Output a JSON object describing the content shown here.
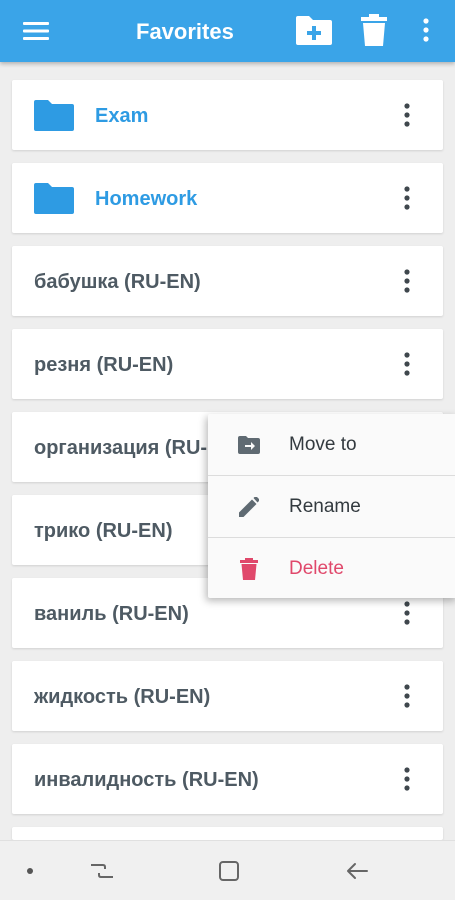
{
  "appbar": {
    "title": "Favorites",
    "icons": [
      "menu-icon",
      "add-folder-icon",
      "trash-icon",
      "more-vert-icon"
    ],
    "color": "#3aa4e8"
  },
  "list": {
    "folders": [
      {
        "label": "Exam"
      },
      {
        "label": "Homework"
      }
    ],
    "words": [
      {
        "label": "бабушка (RU-EN)"
      },
      {
        "label": "резня (RU-EN)"
      },
      {
        "label": "организация (RU-EN)"
      },
      {
        "label": "трико (RU-EN)"
      },
      {
        "label": "ваниль (RU-EN)"
      },
      {
        "label": "жидкость (RU-EN)"
      },
      {
        "label": "инвалидность (RU-EN)"
      }
    ]
  },
  "context_menu": {
    "move_to": "Move to",
    "rename": "Rename",
    "delete": "Delete",
    "delete_color": "#e0486b"
  },
  "navbar": {
    "icons": [
      "dot-icon",
      "recent-apps-icon",
      "home-icon",
      "back-icon"
    ]
  }
}
